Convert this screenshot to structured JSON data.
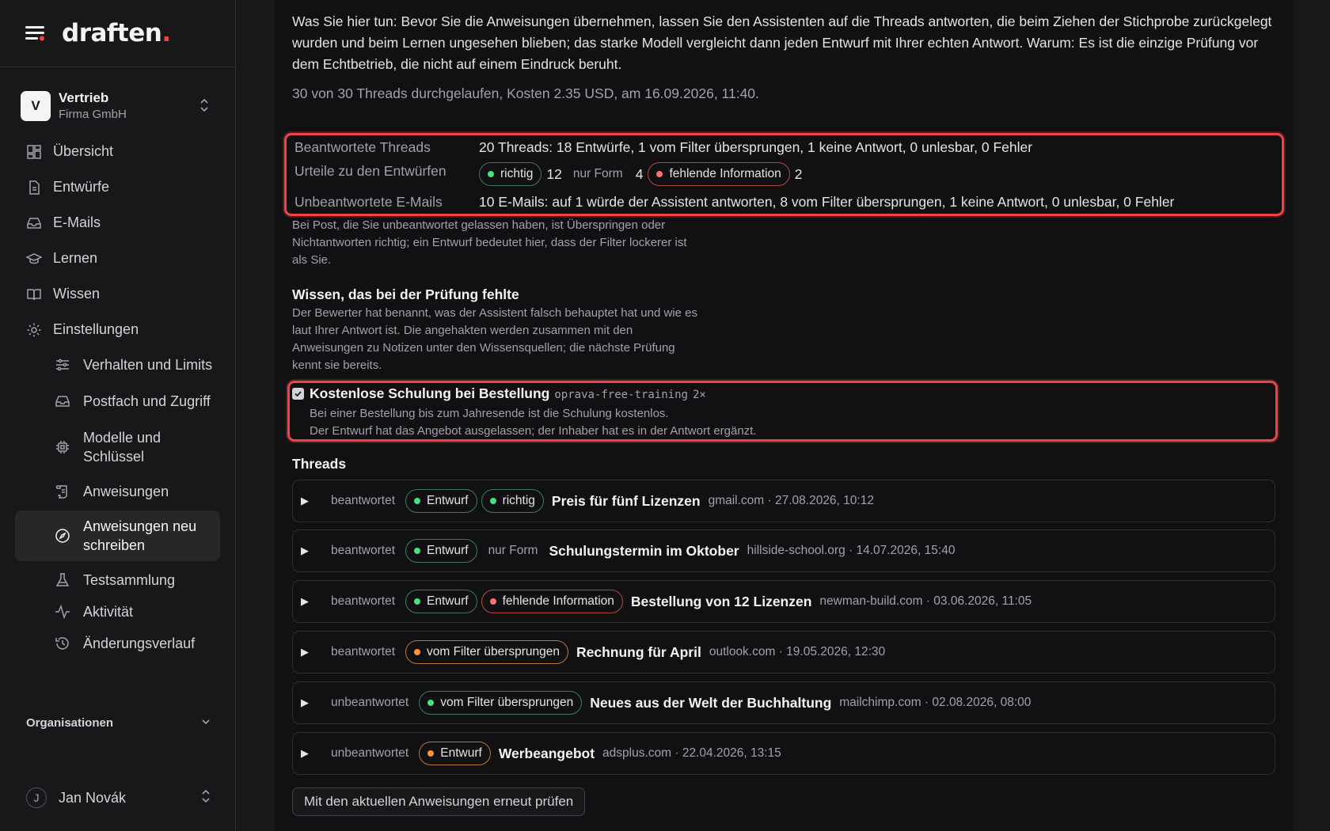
{
  "brand": {
    "logo_text": "draften",
    "logo_dot": "."
  },
  "workspace": {
    "initial": "V",
    "name": "Vertrieb",
    "company": "Firma GmbH"
  },
  "nav": {
    "overview": "Übersicht",
    "drafts": "Entwürfe",
    "emails": "E-Mails",
    "learn": "Lernen",
    "knowledge": "Wissen",
    "settings": "Einstellungen",
    "sub": {
      "behavior": "Verhalten und Limits",
      "mailbox": "Postfach und Zugriff",
      "models": "Modelle und Schlüssel",
      "instructions": "Anweisungen",
      "rewrite": "Anweisungen neu schreiben",
      "testset": "Testsammlung",
      "activity": "Aktivität",
      "history": "Änderungsverlauf"
    },
    "organizations": "Organisationen"
  },
  "user": {
    "initial": "J",
    "name": "Jan Novák"
  },
  "main": {
    "intro": "Was Sie hier tun: Bevor Sie die Anweisungen übernehmen, lassen Sie den Assistenten auf die Threads antworten, die beim Ziehen der Stichprobe zurückgelegt wurden und beim Lernen ungesehen blieben; das starke Modell vergleicht dann jeden Entwurf mit Ihrer echten Antwort. Warum: Es ist die einzige Prüfung vor dem Echtbetrieb, die nicht auf einem Eindruck beruht.",
    "run_info": "30 von 30 Threads durchgelaufen, Kosten 2.35 USD, am 16.09.2026, 11:40.",
    "summary": {
      "answered_label": "Beantwortete Threads",
      "answered_value": "20 Threads: 18 Entwürfe, 1 vom Filter übersprungen, 1 keine Antwort, 0 unlesbar, 0 Fehler",
      "verdicts_label": "Urteile zu den Entwürfen",
      "verdict_correct": "richtig",
      "verdict_correct_count": "12",
      "verdict_form": "nur Form",
      "verdict_form_count": "4",
      "verdict_missing": "fehlende Information",
      "verdict_missing_count": "2",
      "unanswered_label": "Unbeantwortete E-Mails",
      "unanswered_value": "10 E-Mails: auf 1 würde der Assistent antworten, 8 vom Filter übersprungen, 1 keine Antwort, 0 unlesbar, 0 Fehler"
    },
    "note": "Bei Post, die Sie unbeantwortet gelassen haben, ist Überspringen oder Nichtantworten richtig; ein Entwurf bedeutet hier, dass der Filter lockerer ist als Sie.",
    "knowledge_title": "Wissen, das bei der Prüfung fehlte",
    "knowledge_desc": "Der Bewerter hat benannt, was der Assistent falsch behauptet hat und wie es laut Ihrer Antwort ist. Die angehakten werden zusammen mit den Anweisungen zu Notizen unter den Wissensquellen; die nächste Prüfung kennt sie bereits.",
    "knowledge_item": {
      "title": "Kostenlose Schulung bei Bestellung",
      "key": "oprava-free-training",
      "count": "2×",
      "line1": "Bei einer Bestellung bis zum Jahresende ist die Schulung kostenlos.",
      "line2": "Der Entwurf hat das Angebot ausgelassen; der Inhaber hat es in der Antwort ergänzt."
    },
    "threads_title": "Threads",
    "threads": [
      {
        "state": "beantwortet",
        "tag1": "Entwurf",
        "tag2": "richtig",
        "subject": "Preis für fünf Lizenzen",
        "meta": "gmail.com · 27.08.2026, 10:12"
      },
      {
        "state": "beantwortet",
        "tag1": "Entwurf",
        "tag2": "nur Form",
        "subject": "Schulungstermin im Oktober",
        "meta": "hillside-school.org · 14.07.2026, 15:40"
      },
      {
        "state": "beantwortet",
        "tag1": "Entwurf",
        "tag2": "fehlende Information",
        "subject": "Bestellung von 12 Lizenzen",
        "meta": "newman-build.com · 03.06.2026, 11:05"
      },
      {
        "state": "beantwortet",
        "tag1": "vom Filter übersprungen",
        "subject": "Rechnung für April",
        "meta": "outlook.com · 19.05.2026, 12:30"
      },
      {
        "state": "unbeantwortet",
        "tag1": "vom Filter übersprungen",
        "subject": "Neues aus der Welt der Buchhaltung",
        "meta": "mailchimp.com · 02.08.2026, 08:00"
      },
      {
        "state": "unbeantwortet",
        "tag1": "Entwurf",
        "subject": "Werbeangebot",
        "meta": "adsplus.com · 22.04.2026, 13:15"
      }
    ],
    "rerun_button": "Mit den aktuellen Anweisungen erneut prüfen"
  },
  "colors": {
    "accent_red": "#ef4444",
    "green_dot": "#4ade80",
    "red_dot": "#f87171",
    "orange_dot": "#fb923c"
  }
}
